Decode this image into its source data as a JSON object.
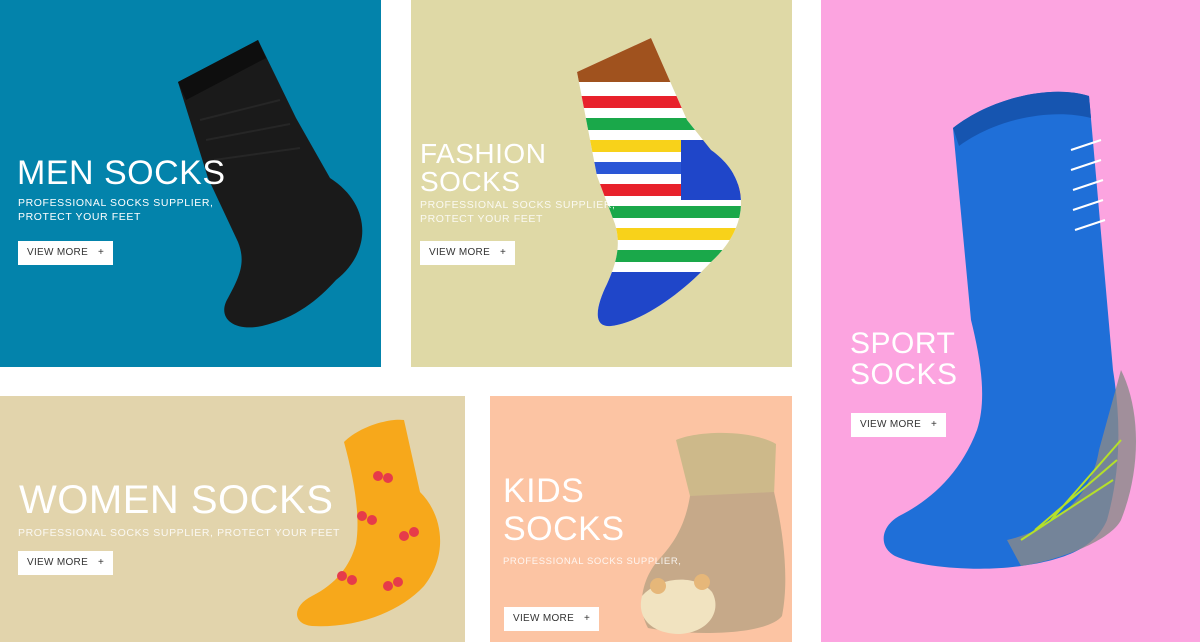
{
  "tiles": {
    "men": {
      "bg": "#0383ab",
      "title": "MEN SOCKS",
      "subtitle_line1": "PROFESSIONAL SOCKS SUPPLIER,",
      "subtitle_line2": "PROTECT YOUR FEET",
      "button_label": "VIEW MORE",
      "button_icon": "+"
    },
    "fashion": {
      "bg": "#dfd9a6",
      "title_line1": "FASHION",
      "title_line2": "SOCKS",
      "subtitle_line1": "PROFESSIONAL SOCKS SUPPLIER,",
      "subtitle_line2": "PROTECT YOUR FEET",
      "button_label": "VIEW MORE",
      "button_icon": "+"
    },
    "sport": {
      "bg": "#fca4e0",
      "title_line1": "SPORT",
      "title_line2": "SOCKS",
      "button_label": "VIEW MORE",
      "button_icon": "+"
    },
    "women": {
      "bg": "#e2d4ac",
      "title": "WOMEN SOCKS",
      "subtitle": "PROFESSIONAL SOCKS SUPPLIER, PROTECT YOUR FEET",
      "button_label": "VIEW MORE",
      "button_icon": "+"
    },
    "kids": {
      "bg": "#fcc4a3",
      "title_line1": "KIDS",
      "title_line2": "SOCKS",
      "subtitle": "PROFESSIONAL SOCKS SUPPLIER,",
      "button_label": "VIEW MORE",
      "button_icon": "+"
    }
  }
}
